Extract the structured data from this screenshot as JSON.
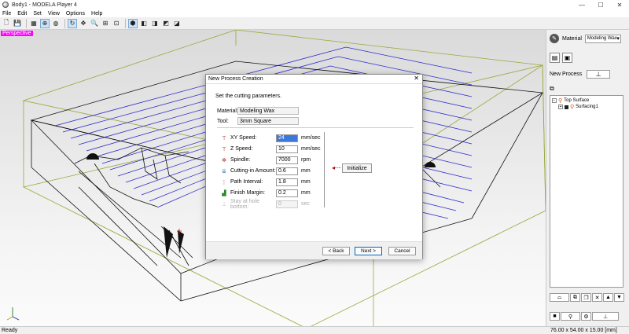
{
  "window": {
    "title": "Body1 - MODELA Player 4",
    "min": "—",
    "max": "☐",
    "close": "✕"
  },
  "menu": [
    "File",
    "Edit",
    "Set",
    "View",
    "Options",
    "Help"
  ],
  "toolbar_icons": [
    "new-file-icon",
    "save-icon",
    "view-mode-icon",
    "globe-view-icon",
    "rotate-icon",
    "refresh-icon",
    "pan-icon",
    "zoom-icon",
    "zoom-box-icon",
    "fit-view-icon",
    "iso-view-icon",
    "front-view-icon",
    "side-view-icon",
    "top-view-icon",
    "back-view-icon"
  ],
  "viewport": {
    "label": "Perspective",
    "axis_label": "x"
  },
  "right_panel": {
    "material_label": "Material",
    "material_value": "Modeling Wax",
    "new_process_label": "New Process",
    "tree": [
      {
        "label": "Top Surface",
        "level": 0
      },
      {
        "label": "Surfacing1",
        "level": 1
      }
    ]
  },
  "dialog": {
    "title": "New Process Creation",
    "close": "✕",
    "instruction": "Set the cutting parameters.",
    "material_label": "Material:",
    "material_value": "Modeling Wax",
    "tool_label": "Tool:",
    "tool_value": "3mm Square",
    "params": [
      {
        "label": "XY Speed:",
        "value": "24",
        "unit": "mm/sec",
        "selected": true,
        "disabled": false
      },
      {
        "label": "Z Speed:",
        "value": "10",
        "unit": "mm/sec",
        "selected": false,
        "disabled": false
      },
      {
        "label": "Spindle:",
        "value": "7000",
        "unit": "rpm",
        "selected": false,
        "disabled": false
      },
      {
        "label": "Cutting-in Amount:",
        "value": "0.6",
        "unit": "mm",
        "selected": false,
        "disabled": false
      },
      {
        "label": "Path Interval:",
        "value": "1.8",
        "unit": "mm",
        "selected": false,
        "disabled": false
      },
      {
        "label": "Finish Margin:",
        "value": "0.2",
        "unit": "mm",
        "selected": false,
        "disabled": false
      },
      {
        "label": "Stay at hole bottom:",
        "value": "0",
        "unit": "sec",
        "selected": false,
        "disabled": true
      }
    ],
    "initialize_label": "Initialize",
    "back_label": "< Back",
    "next_label": "Next >",
    "cancel_label": "Cancel"
  },
  "status": {
    "left": "Ready",
    "right": "76.00 x 54.00 x 15.00 [mm]"
  }
}
